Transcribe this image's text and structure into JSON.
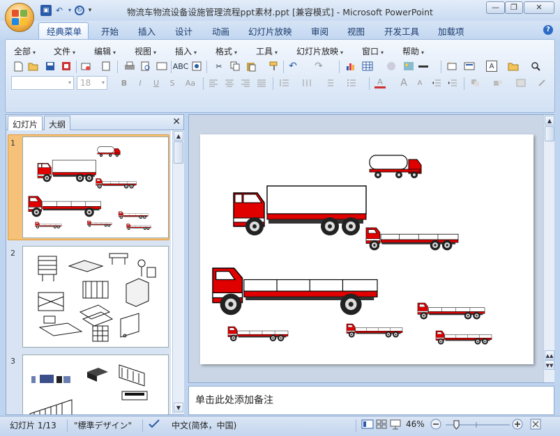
{
  "window": {
    "title": "物流车物流设备设施管理流程ppt素材.ppt [兼容模式] - Microsoft PowerPoint",
    "minimize": "—",
    "restore": "❐",
    "close": "✕"
  },
  "ribbon_tabs": [
    "经典菜单",
    "开始",
    "插入",
    "设计",
    "动画",
    "幻灯片放映",
    "审阅",
    "视图",
    "开发工具",
    "加载项"
  ],
  "active_tab": "经典菜单",
  "menus": [
    "全部",
    "文件",
    "编辑",
    "视图",
    "插入",
    "格式",
    "工具",
    "幻灯片放映",
    "窗口",
    "帮助"
  ],
  "font_size_value": "18",
  "format_buttons": {
    "bold": "B",
    "italic": "I",
    "underline": "U",
    "strike": "S",
    "case": "Aa",
    "font_color": "A",
    "grow": "A",
    "shrink": "A"
  },
  "left_pane": {
    "tabs": [
      "幻灯片",
      "大纲"
    ],
    "slide_numbers": [
      "1",
      "2",
      "3"
    ]
  },
  "notes_placeholder": "单击此处添加备注",
  "status": {
    "slide": "幻灯片 1/13",
    "theme": "\"標準デザイン\"",
    "language": "中文(简体，中国)",
    "zoom": "46%"
  },
  "zoom_level": 0.46,
  "colors": {
    "truck_red": "#e00000",
    "accent": "#2a5ba8",
    "selection": "#f6c27a"
  }
}
